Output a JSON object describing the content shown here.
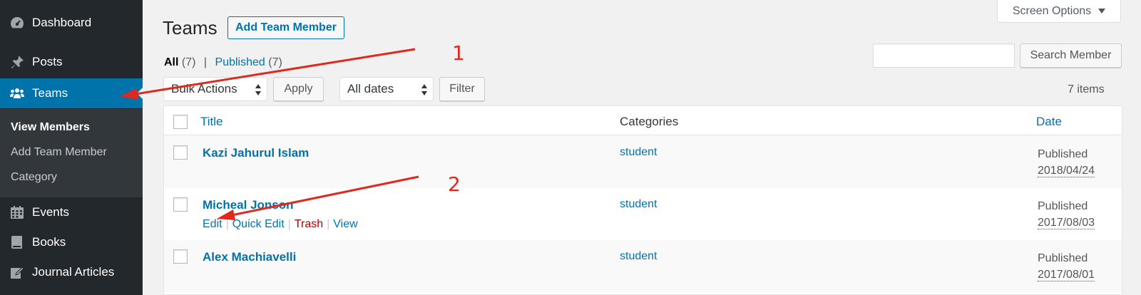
{
  "sidebar": {
    "items": [
      {
        "label": "Dashboard",
        "icon": "dashboard-icon"
      },
      {
        "label": "Posts",
        "icon": "pin-icon"
      },
      {
        "label": "Teams",
        "icon": "groups-icon"
      },
      {
        "label": "Events",
        "icon": "calendar-icon"
      },
      {
        "label": "Books",
        "icon": "book-icon"
      },
      {
        "label": "Journal Articles",
        "icon": "edit-page-icon"
      }
    ],
    "submenu": [
      "View Members",
      "Add Team Member",
      "Category"
    ],
    "active_color": "#0073aa"
  },
  "header": {
    "title": "Teams",
    "add_button": "Add Team Member",
    "screen_options": "Screen Options"
  },
  "filters": {
    "all_label": "All",
    "all_count": "(7)",
    "separator": "|",
    "published_label": "Published",
    "published_count": "(7)",
    "bulk_actions": "Bulk Actions",
    "apply": "Apply",
    "dates": "All dates",
    "filter": "Filter",
    "search_button": "Search Member",
    "items_count": "7 items"
  },
  "table": {
    "columns": {
      "title": "Title",
      "categories": "Categories",
      "date": "Date"
    },
    "rows": [
      {
        "title": "Kazi Jahurul Islam",
        "category": "student",
        "status": "Published",
        "date": "2018/04/24"
      },
      {
        "title": "Micheal Jonson",
        "category": "student",
        "status": "Published",
        "date": "2017/08/03"
      },
      {
        "title": "Alex Machiavelli",
        "category": "student",
        "status": "Published",
        "date": "2017/08/01"
      }
    ],
    "row_actions": {
      "edit": "Edit",
      "quick_edit": "Quick Edit",
      "trash": "Trash",
      "view": "View",
      "separator": "|"
    }
  },
  "annotations": {
    "one": "1",
    "two": "2",
    "color": "#e0281e"
  }
}
